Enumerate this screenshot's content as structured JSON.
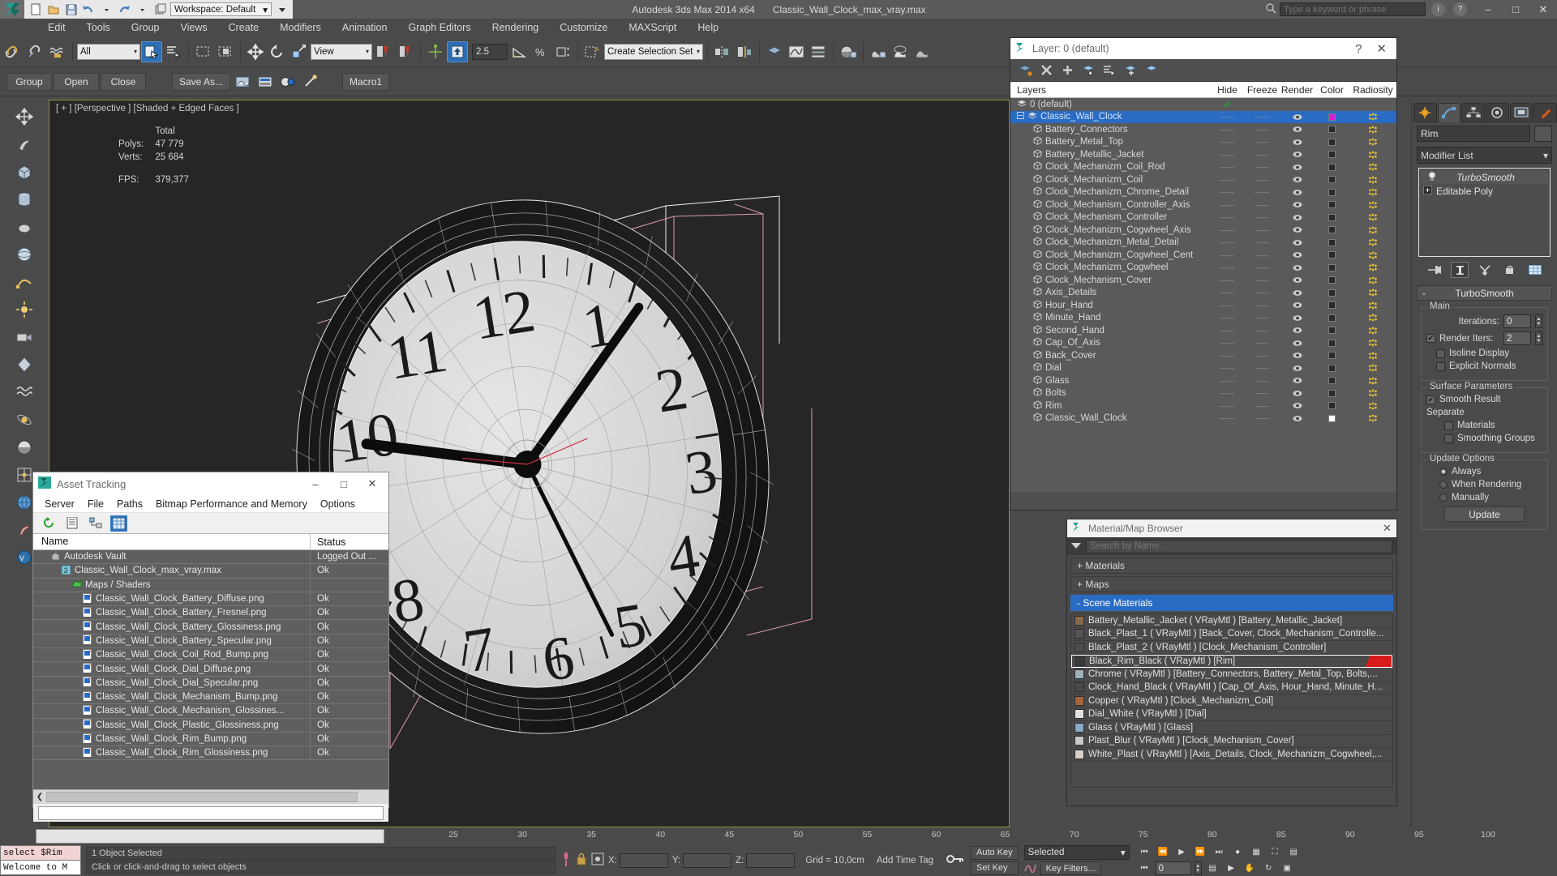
{
  "titlebar": {
    "app_title": "Autodesk 3ds Max  2014 x64",
    "file_title": "Classic_Wall_Clock_max_vray.max",
    "workspace_label": "Workspace: Default",
    "search_placeholder": "Type a keyword or phrase",
    "min_label": "–",
    "max_label": "□",
    "close_label": "✕",
    "help_label": "?",
    "info_label": "i"
  },
  "menu": {
    "items": [
      "Edit",
      "Tools",
      "Group",
      "Views",
      "Create",
      "Modifiers",
      "Animation",
      "Graph Editors",
      "Rendering",
      "Customize",
      "MAXScript",
      "Help"
    ]
  },
  "toolbar": {
    "selection_filter": "All",
    "ref_coord_sys": "View",
    "spinner_value": "2.5",
    "named_selection_placeholder": "Create Selection Set"
  },
  "toolbar2": {
    "group_label": "Group",
    "open_label": "Open",
    "close_label": "Close",
    "save_as_label": "Save As...",
    "macro_label": "Macro1"
  },
  "viewport": {
    "label": "[ + ] [Perspective ] [Shaded + Edged Faces ]",
    "stats": [
      {
        "key": "",
        "value": "Total"
      },
      {
        "key": "Polys:",
        "value": "47 779"
      },
      {
        "key": "Verts:",
        "value": "25 684"
      },
      {
        "key": "FPS:",
        "value": "379,377"
      }
    ]
  },
  "layer_panel": {
    "title": "Layer: 0 (default)",
    "help_label": "?",
    "close_label": "✕",
    "columns": [
      "Layers",
      "Hide",
      "Freeze",
      "Render",
      "Color",
      "Radiosity"
    ],
    "rows": [
      {
        "name": "0 (default)",
        "type": "layer",
        "indent": 0,
        "selected": false,
        "hide": "",
        "freeze": "",
        "render": "",
        "color": "",
        "radiosity": "",
        "check": true
      },
      {
        "name": "Classic_Wall_Clock",
        "type": "layer",
        "indent": 0,
        "selected": true,
        "hide": "dash",
        "freeze": "dash",
        "render": "eye",
        "color": "magenta",
        "radiosity": "yes",
        "check": false
      },
      {
        "name": "Battery_Connectors",
        "type": "object",
        "indent": 1,
        "selected": false,
        "hide": "dash",
        "freeze": "dash",
        "render": "eye",
        "color": "dark",
        "radiosity": "yes"
      },
      {
        "name": "Battery_Metal_Top",
        "type": "object",
        "indent": 1,
        "selected": false,
        "hide": "dash",
        "freeze": "dash",
        "render": "eye",
        "color": "dark",
        "radiosity": "yes"
      },
      {
        "name": "Battery_Metallic_Jacket",
        "type": "object",
        "indent": 1,
        "selected": false,
        "hide": "dash",
        "freeze": "dash",
        "render": "eye",
        "color": "dark",
        "radiosity": "yes"
      },
      {
        "name": "Clock_Mechanizm_Coil_Rod",
        "type": "object",
        "indent": 1,
        "selected": false,
        "hide": "dash",
        "freeze": "dash",
        "render": "eye",
        "color": "dark",
        "radiosity": "yes"
      },
      {
        "name": "Clock_Mechanizm_Coil",
        "type": "object",
        "indent": 1,
        "selected": false,
        "hide": "dash",
        "freeze": "dash",
        "render": "eye",
        "color": "dark",
        "radiosity": "yes"
      },
      {
        "name": "Clock_Mechanizm_Chrome_Detail",
        "type": "object",
        "indent": 1,
        "selected": false,
        "hide": "dash",
        "freeze": "dash",
        "render": "eye",
        "color": "dark",
        "radiosity": "yes"
      },
      {
        "name": "Clock_Mechanism_Controller_Axis",
        "type": "object",
        "indent": 1,
        "selected": false,
        "hide": "dash",
        "freeze": "dash",
        "render": "eye",
        "color": "dark",
        "radiosity": "yes"
      },
      {
        "name": "Clock_Mechanism_Controller",
        "type": "object",
        "indent": 1,
        "selected": false,
        "hide": "dash",
        "freeze": "dash",
        "render": "eye",
        "color": "dark",
        "radiosity": "yes"
      },
      {
        "name": "Clock_Mechanizm_Cogwheel_Axis",
        "type": "object",
        "indent": 1,
        "selected": false,
        "hide": "dash",
        "freeze": "dash",
        "render": "eye",
        "color": "dark",
        "radiosity": "yes"
      },
      {
        "name": "Clock_Mechanizm_Metal_Detail",
        "type": "object",
        "indent": 1,
        "selected": false,
        "hide": "dash",
        "freeze": "dash",
        "render": "eye",
        "color": "dark",
        "radiosity": "yes"
      },
      {
        "name": "Clock_Mechanizm_Cogwheel_Cent",
        "type": "object",
        "indent": 1,
        "selected": false,
        "hide": "dash",
        "freeze": "dash",
        "render": "eye",
        "color": "dark",
        "radiosity": "yes"
      },
      {
        "name": "Clock_Mechanizm_Cogwheel",
        "type": "object",
        "indent": 1,
        "selected": false,
        "hide": "dash",
        "freeze": "dash",
        "render": "eye",
        "color": "dark",
        "radiosity": "yes"
      },
      {
        "name": "Clock_Mechanism_Cover",
        "type": "object",
        "indent": 1,
        "selected": false,
        "hide": "dash",
        "freeze": "dash",
        "render": "eye",
        "color": "dark",
        "radiosity": "yes"
      },
      {
        "name": "Axis_Details",
        "type": "object",
        "indent": 1,
        "selected": false,
        "hide": "dash",
        "freeze": "dash",
        "render": "eye",
        "color": "dark",
        "radiosity": "yes"
      },
      {
        "name": "Hour_Hand",
        "type": "object",
        "indent": 1,
        "selected": false,
        "hide": "dash",
        "freeze": "dash",
        "render": "eye",
        "color": "dark",
        "radiosity": "yes"
      },
      {
        "name": "Minute_Hand",
        "type": "object",
        "indent": 1,
        "selected": false,
        "hide": "dash",
        "freeze": "dash",
        "render": "eye",
        "color": "dark",
        "radiosity": "yes"
      },
      {
        "name": "Second_Hand",
        "type": "object",
        "indent": 1,
        "selected": false,
        "hide": "dash",
        "freeze": "dash",
        "render": "eye",
        "color": "dark",
        "radiosity": "yes"
      },
      {
        "name": "Cap_Of_Axis",
        "type": "object",
        "indent": 1,
        "selected": false,
        "hide": "dash",
        "freeze": "dash",
        "render": "eye",
        "color": "dark",
        "radiosity": "yes"
      },
      {
        "name": "Back_Cover",
        "type": "object",
        "indent": 1,
        "selected": false,
        "hide": "dash",
        "freeze": "dash",
        "render": "eye",
        "color": "dark",
        "radiosity": "yes"
      },
      {
        "name": "Dial",
        "type": "object",
        "indent": 1,
        "selected": false,
        "hide": "dash",
        "freeze": "dash",
        "render": "eye",
        "color": "dark",
        "radiosity": "yes"
      },
      {
        "name": "Glass",
        "type": "object",
        "indent": 1,
        "selected": false,
        "hide": "dash",
        "freeze": "dash",
        "render": "eye",
        "color": "dark",
        "radiosity": "yes"
      },
      {
        "name": "Bolts",
        "type": "object",
        "indent": 1,
        "selected": false,
        "hide": "dash",
        "freeze": "dash",
        "render": "eye",
        "color": "dark",
        "radiosity": "yes"
      },
      {
        "name": "Rim",
        "type": "object",
        "indent": 1,
        "selected": false,
        "hide": "dash",
        "freeze": "dash",
        "render": "eye",
        "color": "dark",
        "radiosity": "yes"
      },
      {
        "name": "Classic_Wall_Clock",
        "type": "object",
        "indent": 1,
        "selected": false,
        "hide": "dash",
        "freeze": "dash",
        "render": "eye",
        "color": "white",
        "radiosity": "yes"
      }
    ]
  },
  "material_browser": {
    "title": "Material/Map Browser",
    "close_label": "✕",
    "search_placeholder": "Search by Name ...",
    "groups": [
      {
        "label": "+ Materials",
        "selected": false
      },
      {
        "label": "+ Maps",
        "selected": false
      },
      {
        "label": "- Scene Materials",
        "selected": true
      }
    ],
    "materials": [
      {
        "label": "Battery_Metallic_Jacket  ( VRayMtl ) [Battery_Metallic_Jacket]",
        "selected": false,
        "swatch": "#8a6b4a"
      },
      {
        "label": "Black_Plast_1 ( VRayMtl ) [Back_Cover, Clock_Mechanism_Controlle...",
        "selected": false,
        "swatch": "#555555"
      },
      {
        "label": "Black_Plast_2 ( VRayMtl ) [Clock_Mechanism_Controller]",
        "selected": false,
        "swatch": "#4d4d4d"
      },
      {
        "label": "Black_Rim_Black ( VRayMtl ) [Rim]",
        "selected": true,
        "swatch": "#3a3a3a"
      },
      {
        "label": "Chrome ( VRayMtl ) [Battery_Connectors, Battery_Metal_Top, Bolts,...",
        "selected": false,
        "swatch": "#9fb0bd"
      },
      {
        "label": "Clock_Hand_Black ( VRayMtl ) [Cap_Of_Axis, Hour_Hand, Minute_H...",
        "selected": false,
        "swatch": "#4a4a4a"
      },
      {
        "label": "Copper ( VRayMtl ) [Clock_Mechanizm_Coil]",
        "selected": false,
        "swatch": "#a8643a"
      },
      {
        "label": "Dial_White ( VRayMtl ) [Dial]",
        "selected": false,
        "swatch": "#e2e2e2"
      },
      {
        "label": "Glass ( VRayMtl ) [Glass]",
        "selected": false,
        "swatch": "#8aa8cc"
      },
      {
        "label": "Plast_Blur ( VRayMtl ) [Clock_Mechanism_Cover]",
        "selected": false,
        "swatch": "#c8c8c8"
      },
      {
        "label": "White_Plast ( VRayMtl ) [Axis_Details, Clock_Mechanizm_Cogwheel,...",
        "selected": false,
        "swatch": "#d8d2c8"
      }
    ]
  },
  "asset_tracking": {
    "title": "Asset Tracking",
    "min_label": "–",
    "max_label": "□",
    "close_label": "✕",
    "menu": [
      "Server",
      "File",
      "Paths",
      "Bitmap Performance and Memory",
      "Options"
    ],
    "columns": {
      "name": "Name",
      "status": "Status"
    },
    "rows": [
      {
        "name": "Autodesk Vault",
        "status": "Logged Out ...",
        "indent": 1,
        "icon": "vault-icon"
      },
      {
        "name": "Classic_Wall_Clock_max_vray.max",
        "status": "Ok",
        "indent": 2,
        "icon": "max-file-icon"
      },
      {
        "name": "Maps / Shaders",
        "status": "",
        "indent": 3,
        "icon": "maps-icon"
      },
      {
        "name": "Classic_Wall_Clock_Battery_Diffuse.png",
        "status": "Ok",
        "indent": 4,
        "icon": "png-icon"
      },
      {
        "name": "Classic_Wall_Clock_Battery_Fresnel.png",
        "status": "Ok",
        "indent": 4,
        "icon": "png-icon"
      },
      {
        "name": "Classic_Wall_Clock_Battery_Glossiness.png",
        "status": "Ok",
        "indent": 4,
        "icon": "png-icon"
      },
      {
        "name": "Classic_Wall_Clock_Battery_Specular.png",
        "status": "Ok",
        "indent": 4,
        "icon": "png-icon"
      },
      {
        "name": "Classic_Wall_Clock_Coil_Rod_Bump.png",
        "status": "Ok",
        "indent": 4,
        "icon": "png-icon"
      },
      {
        "name": "Classic_Wall_Clock_Dial_Diffuse.png",
        "status": "Ok",
        "indent": 4,
        "icon": "png-icon"
      },
      {
        "name": "Classic_Wall_Clock_Dial_Specular.png",
        "status": "Ok",
        "indent": 4,
        "icon": "png-icon"
      },
      {
        "name": "Classic_Wall_Clock_Mechanism_Bump.png",
        "status": "Ok",
        "indent": 4,
        "icon": "png-icon"
      },
      {
        "name": "Classic_Wall_Clock_Mechanism_Glossines...",
        "status": "Ok",
        "indent": 4,
        "icon": "png-icon"
      },
      {
        "name": "Classic_Wall_Clock_Plastic_Glossiness.png",
        "status": "Ok",
        "indent": 4,
        "icon": "png-icon"
      },
      {
        "name": "Classic_Wall_Clock_Rim_Bump.png",
        "status": "Ok",
        "indent": 4,
        "icon": "png-icon"
      },
      {
        "name": "Classic_Wall_Clock_Rim_Glossiness.png",
        "status": "Ok",
        "indent": 4,
        "icon": "png-icon"
      }
    ]
  },
  "command_panel": {
    "object_name": "Rim",
    "modifier_list_label": "Modifier List",
    "stack": [
      {
        "label": "TurboSmooth",
        "italic": true
      },
      {
        "label": "Editable Poly",
        "italic": false
      }
    ],
    "turbosmooth": {
      "rollout_title": "TurboSmooth",
      "collapse_glyph": "-",
      "main_label": "Main",
      "iterations_label": "Iterations:",
      "iterations_value": "0",
      "render_iters_label": "Render Iters:",
      "render_iters_value": "2",
      "render_iters_checked": true,
      "isoline_label": "Isoline Display",
      "isoline_checked": false,
      "explicit_normals_label": "Explicit Normals",
      "explicit_normals_checked": false,
      "surface_params_label": "Surface Parameters",
      "smooth_result_label": "Smooth Result",
      "smooth_result_checked": true,
      "separate_label": "Separate",
      "materials_label": "Materials",
      "materials_checked": false,
      "smoothing_groups_label": "Smoothing Groups",
      "smoothing_groups_checked": false,
      "update_options_label": "Update Options",
      "update_modes": [
        {
          "label": "Always",
          "selected": true
        },
        {
          "label": "When Rendering",
          "selected": false
        },
        {
          "label": "Manually",
          "selected": false
        }
      ],
      "update_button": "Update"
    }
  },
  "trackbar": {
    "ticks": [
      "25",
      "30",
      "35",
      "40",
      "45",
      "50",
      "55",
      "60",
      "65",
      "70",
      "75",
      "80",
      "85",
      "90",
      "95",
      "100"
    ]
  },
  "statusbar": {
    "maxscript_prompt": "select $Rim",
    "maxscript_listener": "Welcome to M",
    "line1": "1 Object Selected",
    "line2": "Click or click-and-drag to select objects",
    "x_label": "X:",
    "y_label": "Y:",
    "z_label": "Z:",
    "x_value": "",
    "y_value": "",
    "z_value": "",
    "grid_label": "Grid = 10,0cm",
    "add_time_tag": "Add Time Tag",
    "auto_key": "Auto Key",
    "set_key": "Set Key",
    "key_mode": "Selected",
    "key_filters": "Key Filters...",
    "frame_value": "0"
  }
}
